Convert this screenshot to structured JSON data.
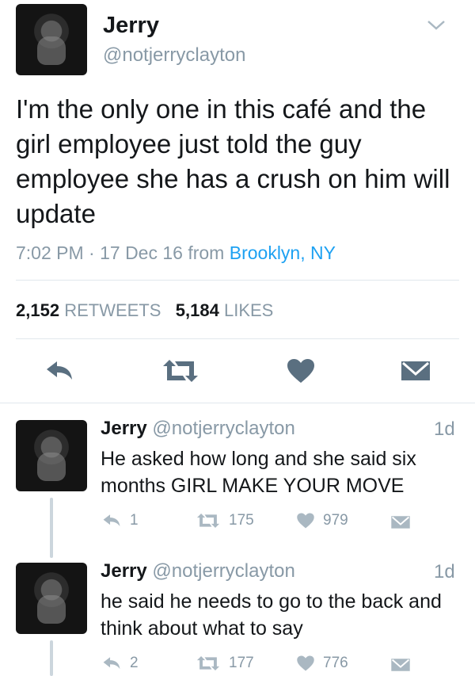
{
  "main_tweet": {
    "name": "Jerry",
    "handle": "@notjerryclayton",
    "text": "I'm the only one in this café and the girl employee just told the guy employee she has a crush on him will update",
    "time": "7:02 PM · 17 Dec 16",
    "from_label": "from",
    "location": "Brooklyn, NY",
    "retweets_count": "2,152",
    "retweets_label": "RETWEETS",
    "likes_count": "5,184",
    "likes_label": "LIKES"
  },
  "replies": [
    {
      "name": "Jerry",
      "handle": "@notjerryclayton",
      "age": "1d",
      "text": "He asked how long and she said six months GIRL MAKE YOUR MOVE",
      "reply_count": "1",
      "retweet_count": "175",
      "like_count": "979"
    },
    {
      "name": "Jerry",
      "handle": "@notjerryclayton",
      "age": "1d",
      "text": "he said he needs to go to the back and think about what to say",
      "reply_count": "2",
      "retweet_count": "177",
      "like_count": "776"
    }
  ],
  "colors": {
    "text": "#14171a",
    "muted": "#8899a6",
    "link": "#1da1f2",
    "icon": "#5a6f80"
  }
}
